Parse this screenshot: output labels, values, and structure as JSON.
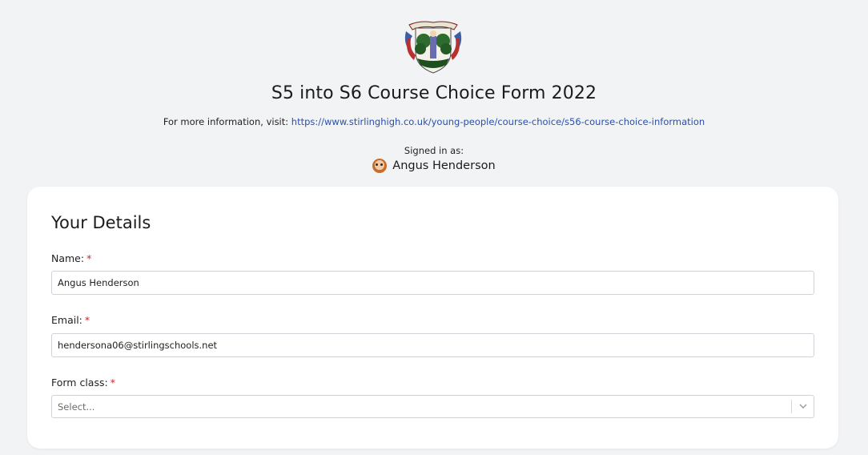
{
  "header": {
    "title": "S5 into S6 Course Choice Form 2022",
    "info_prefix": "For more information, visit: ",
    "info_link": "https://www.stirlinghigh.co.uk/young-people/course-choice/s56-course-choice-information",
    "signed_in_label": "Signed in as:",
    "signed_in_user": "Angus Henderson"
  },
  "section": {
    "title": "Your Details"
  },
  "fields": {
    "name": {
      "label": "Name:",
      "required_mark": "*",
      "value": "Angus Henderson"
    },
    "email": {
      "label": "Email:",
      "required_mark": "*",
      "value": "hendersona06@stirlingschools.net"
    },
    "form_class": {
      "label": "Form class:",
      "required_mark": "*",
      "placeholder": "Select..."
    }
  },
  "colors": {
    "background": "#f2f3f5",
    "card": "#ffffff",
    "link": "#2a4fa8",
    "required": "#c62828"
  },
  "icons": {
    "crest": "school-crest-icon",
    "avatar": "user-avatar-icon",
    "dropdown": "chevron-down-icon"
  }
}
